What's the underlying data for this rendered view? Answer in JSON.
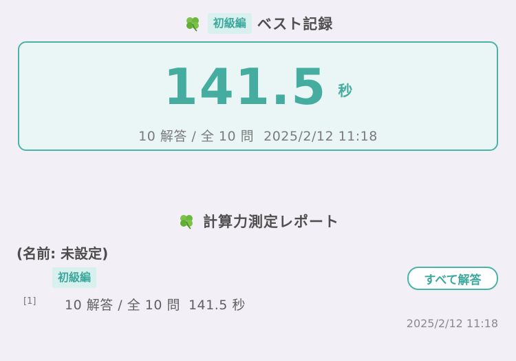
{
  "colors": {
    "accent": "#49b3a7",
    "accent_text": "#3ca89c",
    "badge_bg": "#d8f1ee",
    "box_bg": "#e9f6f5",
    "page_bg": "#f3eff6"
  },
  "best": {
    "icon": "clover-icon",
    "level": "初級編",
    "title": "ベスト記録",
    "time": "141.5",
    "unit": "秒",
    "answered": "10 解答 / 全 10 問",
    "datetime": "2025/2/12 11:18"
  },
  "report": {
    "icon": "clover-icon",
    "title": "計算力測定レポート",
    "name_line": "(名前: 未設定)",
    "all_answers_label": "すべて解答",
    "entries": [
      {
        "level": "初級編",
        "index": "[1]",
        "answered": "10 解答 / 全 10 問",
        "time": "141.5 秒",
        "datetime": "2025/2/12 11:18"
      }
    ]
  }
}
